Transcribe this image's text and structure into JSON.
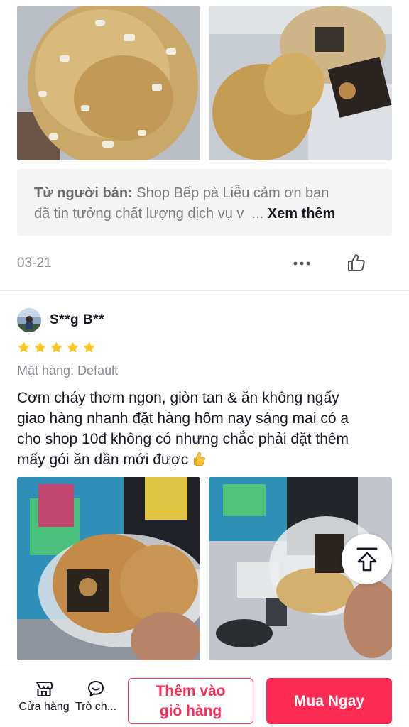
{
  "review_prev": {
    "seller_reply": {
      "label": "Từ người bán:",
      "text_line1": "Shop Bếp pà Liễu cảm ơn bạn",
      "text_line2": "đã tin tưởng chất lượng dịch vụ v",
      "ellipsis": "...",
      "more_label": "Xem thêm"
    },
    "date": "03-21",
    "icons": {
      "more": "more-dots-icon",
      "like": "thumbs-up-icon"
    }
  },
  "review": {
    "username": "S**g B**",
    "rating": 5,
    "variant": "Mặt hàng: Default",
    "text_lines": [
      "Cơm cháy thơm ngon, giòn tan & ăn không ngấy",
      "giao hàng nhanh đặt hàng hôm nay sáng mai có ạ",
      "cho shop 10đ không có nhưng chắc phải đặt thêm",
      "mấy gói ăn dần mới được"
    ],
    "emoji": "thumbs-up-emoji"
  },
  "colors": {
    "accent": "#fe2c55",
    "star": "#fdc624",
    "text": "#161823",
    "muted": "#8a8b91"
  },
  "bottom_bar": {
    "shop_label": "Cửa hàng",
    "chat_label": "Trò ch...",
    "add_to_cart_line1": "Thêm vào",
    "add_to_cart_line2": "giỏ hàng",
    "buy_now": "Mua Ngay"
  }
}
